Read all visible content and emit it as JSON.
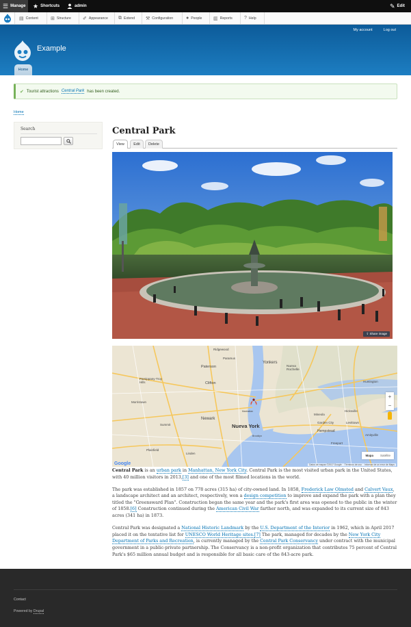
{
  "toolbar": {
    "manage": "Manage",
    "shortcuts": "Shortcuts",
    "user": "admin",
    "edit": "Edit"
  },
  "tray": {
    "items": [
      "Content",
      "Structure",
      "Appearance",
      "Extend",
      "Configuration",
      "People",
      "Reports",
      "Help"
    ]
  },
  "header": {
    "site_name": "Example",
    "my_account": "My account",
    "log_out": "Log out",
    "primary_tab": "Home"
  },
  "status_message": {
    "prefix": "Tourist attractions",
    "link": "Central Park",
    "suffix": "has been created."
  },
  "breadcrumb": "Home",
  "sidebar": {
    "search_title": "Search"
  },
  "node": {
    "title": "Central Park",
    "tabs": [
      "View",
      "Edit",
      "Delete"
    ],
    "share_image": "Share image"
  },
  "map": {
    "labels": [
      "Ridgewood",
      "Paramus",
      "Yonkers",
      "Nueva Rochelle",
      "Paterson",
      "Parsippany-Troy Hills",
      "Clifton",
      "Morristown",
      "Newark",
      "Nueva York",
      "Summit",
      "Huntington",
      "Hicksville",
      "Mineola",
      "Garden City",
      "Levittown",
      "Hempstead",
      "Amityville",
      "Freeport",
      "Plainfield",
      "Linden",
      "Manhattan",
      "Brooklyn"
    ],
    "type_map": "Mapa",
    "type_satellite": "Satélite",
    "google": "Google",
    "attribution": "Datos de mapas ©2017 Google",
    "terms": "Términos de uso",
    "report": "Informar de un error de Maps",
    "zoom_in": "+",
    "zoom_out": "−"
  },
  "body": {
    "p1": {
      "b": "Central Park",
      "t1": " is an ",
      "a1": "urban park",
      "t2": " in ",
      "a2": "Manhattan, New York City",
      "t3": ". Central Park is the most visited urban park in the United States, with 40 million visitors in 2013,",
      "a3": "[3]",
      "t4": " and one of the most filmed locations in the world."
    },
    "p2": {
      "t1": "The park was established in 1857 on 778 acres (315 ha) of city-owned land. In 1858, ",
      "a1": "Frederick Law Olmsted",
      "t2": " and ",
      "a2": "Calvert Vaux",
      "t3": ", a landscape architect and an architect, respectively, won a ",
      "a3": "design competition",
      "t4": " to improve and expand the park with a plan they titled the \"Greensward Plan\". Construction began the same year and the park's first area was opened to the public in the winter of 1858.",
      "a4": "[6]",
      "t5": " Construction continued during the ",
      "a5": "American Civil War",
      "t6": " farther north, and was expanded to its current size of 843 acres (341 ha) in 1873."
    },
    "p3": {
      "t1": "Central Park was designated a ",
      "a1": "National Historic Landmark",
      "t2": " by the ",
      "a2": "U.S. Department of the Interior",
      "t3": " in 1962, which in April 2017 placed it on the tentative list for ",
      "a3": "UNESCO World Heritage sites.",
      "a4": "[7]",
      "t4": " The park, managed for decades by the ",
      "a5": "New York City Department of Parks and Recreation",
      "t5": ", is currently managed by the ",
      "a6": "Central Park Conservancy",
      "t6": " under contract with the municipal government in a public-private partnership. The Conservancy is a non-profit organization that contributes 75 percent of Central Park's $65 million annual budget and is responsible for all basic care of the 843-acre park."
    }
  },
  "footer": {
    "contact": "Contact",
    "powered_prefix": "Powered by ",
    "powered_link": "Drupal"
  }
}
